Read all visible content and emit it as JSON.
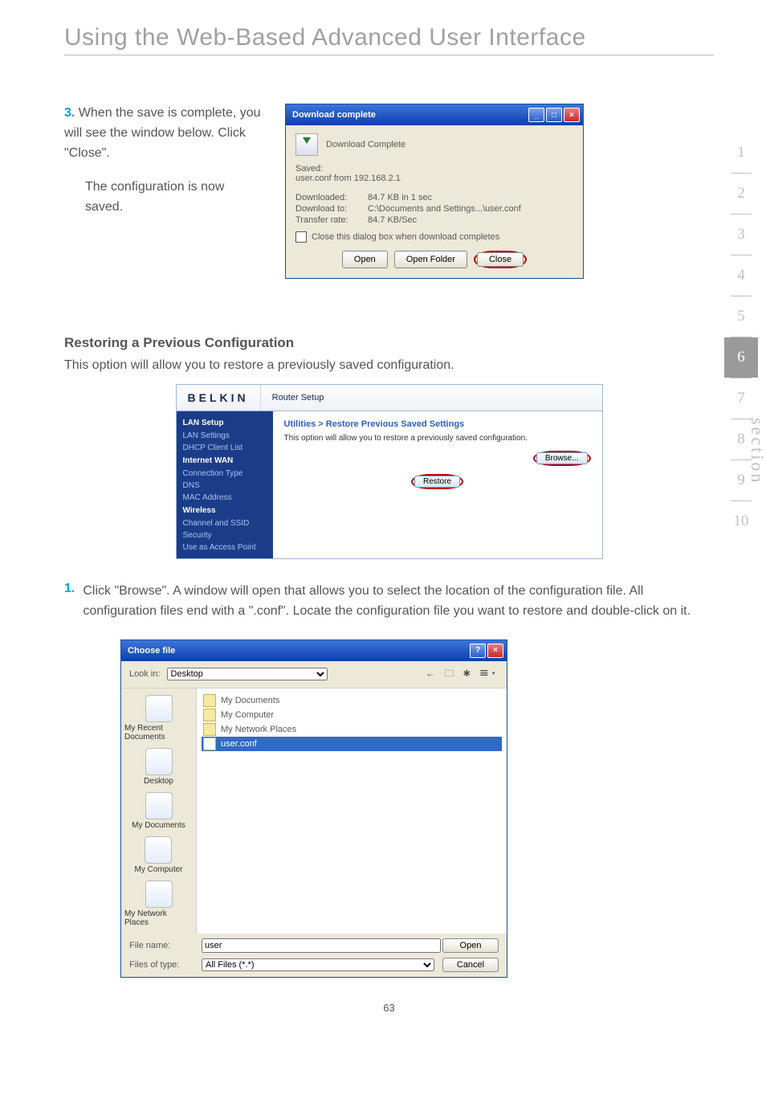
{
  "title": "Using the Web-Based Advanced User Interface",
  "page_number": "63",
  "sections": [
    "1",
    "2",
    "3",
    "4",
    "5",
    "6",
    "7",
    "8",
    "9",
    "10"
  ],
  "section_label": "section",
  "active_section": "6",
  "step3": {
    "num": "3.",
    "text": "When the save is complete, you will see the window below. Click \"Close\".",
    "follow": "The configuration is now saved."
  },
  "download_dialog": {
    "title": "Download complete",
    "heading": "Download Complete",
    "saved_label": "Saved:",
    "saved_val": "user.conf from 192.168.2.1",
    "rows": {
      "downloaded_k": "Downloaded:",
      "downloaded_v": "84.7 KB in 1 sec",
      "to_k": "Download to:",
      "to_v": "C:\\Documents and Settings...\\user.conf",
      "rate_k": "Transfer rate:",
      "rate_v": "84.7 KB/Sec"
    },
    "checkbox": "Close this dialog box when download completes",
    "buttons": {
      "open": "Open",
      "folder": "Open Folder",
      "close": "Close"
    }
  },
  "restore": {
    "heading": "Restoring a Previous Configuration",
    "intro": "This option will allow you to restore a previously saved configuration."
  },
  "belkin": {
    "logo": "BELKIN",
    "tab": "Router Setup",
    "nav": {
      "h1": "LAN Setup",
      "i1": "LAN Settings",
      "i2": "DHCP Client List",
      "h2": "Internet WAN",
      "i3": "Connection Type",
      "i4": "DNS",
      "i5": "MAC Address",
      "h3": "Wireless",
      "i6": "Channel and SSID",
      "i7": "Security",
      "i8": "Use as Access Point"
    },
    "main": {
      "title": "Utilities > Restore Previous Saved Settings",
      "sub": "This option will allow you to restore a previously saved configuration.",
      "browse": "Browse...",
      "restore": "Restore"
    }
  },
  "step1": {
    "num": "1.",
    "text": "Click \"Browse\". A window will open that allows you to select the location of the configuration file. All configuration files end with a \".conf\". Locate the configuration file you want to restore and double-click on it."
  },
  "choose": {
    "title": "Choose file",
    "lookin_label": "Look in:",
    "lookin_value": "Desktop",
    "places": {
      "recent": "My Recent Documents",
      "desktop": "Desktop",
      "mydocs": "My Documents",
      "mycomp": "My Computer",
      "mynet": "My Network Places"
    },
    "items": {
      "mydocs": "My Documents",
      "mycomp": "My Computer",
      "mynet": "My Network Places",
      "userconf": "user.conf"
    },
    "filename_label": "File name:",
    "filename_value": "user",
    "filetype_label": "Files of type:",
    "filetype_value": "All Files (*.*)",
    "open_btn": "Open",
    "cancel_btn": "Cancel"
  }
}
